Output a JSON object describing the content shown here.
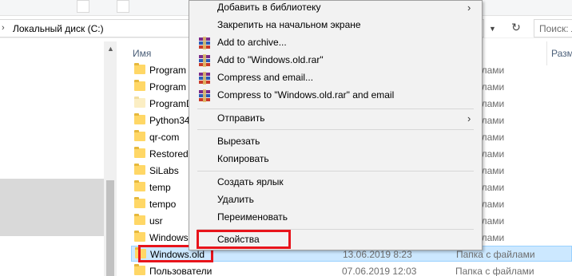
{
  "address_bar": {
    "path": "Локальный диск (C:)",
    "search_placeholder": "Поиск: Ло"
  },
  "columns": {
    "name": "Имя",
    "size": "Разм"
  },
  "files": [
    {
      "name": "Program",
      "date": "",
      "type": "с файлами"
    },
    {
      "name": "Program",
      "date": "",
      "type": "с файлами"
    },
    {
      "name": "ProgramD",
      "date": "",
      "type": "с файлами"
    },
    {
      "name": "Python34",
      "date": "",
      "type": "с файлами"
    },
    {
      "name": "qr-com",
      "date": "",
      "type": "с файлами"
    },
    {
      "name": "Restored",
      "date": "",
      "type": "с файлами"
    },
    {
      "name": "SiLabs",
      "date": "",
      "type": "с файлами"
    },
    {
      "name": "temp",
      "date": "",
      "type": "с файлами"
    },
    {
      "name": "tempo",
      "date": "",
      "type": "с файлами"
    },
    {
      "name": "usr",
      "date": "",
      "type": "с файлами"
    },
    {
      "name": "Windows",
      "date": "",
      "type": "с файлами"
    },
    {
      "name": "Windows.old",
      "date": "13.06.2019 8:23",
      "type": "Папка с файлами"
    },
    {
      "name": "Пользователи",
      "date": "07.06.2019 12:03",
      "type": "Папка с файлами"
    }
  ],
  "context_menu": {
    "add_to_library": "Добавить в библиотеку",
    "pin_start": "Закрепить на начальном экране",
    "add_to_archive": "Add to archive...",
    "add_to_rar": "Add to \"Windows.old.rar\"",
    "compress_email": "Compress and email...",
    "compress_rar_email": "Compress to \"Windows.old.rar\" and email",
    "send_to": "Отправить",
    "cut": "Вырезать",
    "copy": "Копировать",
    "create_shortcut": "Создать ярлык",
    "delete": "Удалить",
    "rename": "Переименовать",
    "properties": "Свойства"
  },
  "icons": {
    "winrar": "winrar-books-icon",
    "submenu": "chevron-right-icon",
    "folder": "folder-icon"
  },
  "colors": {
    "highlight_outline": "#e8141b",
    "selection": "#cce8ff",
    "menu_bg": "#f2f2f2"
  }
}
